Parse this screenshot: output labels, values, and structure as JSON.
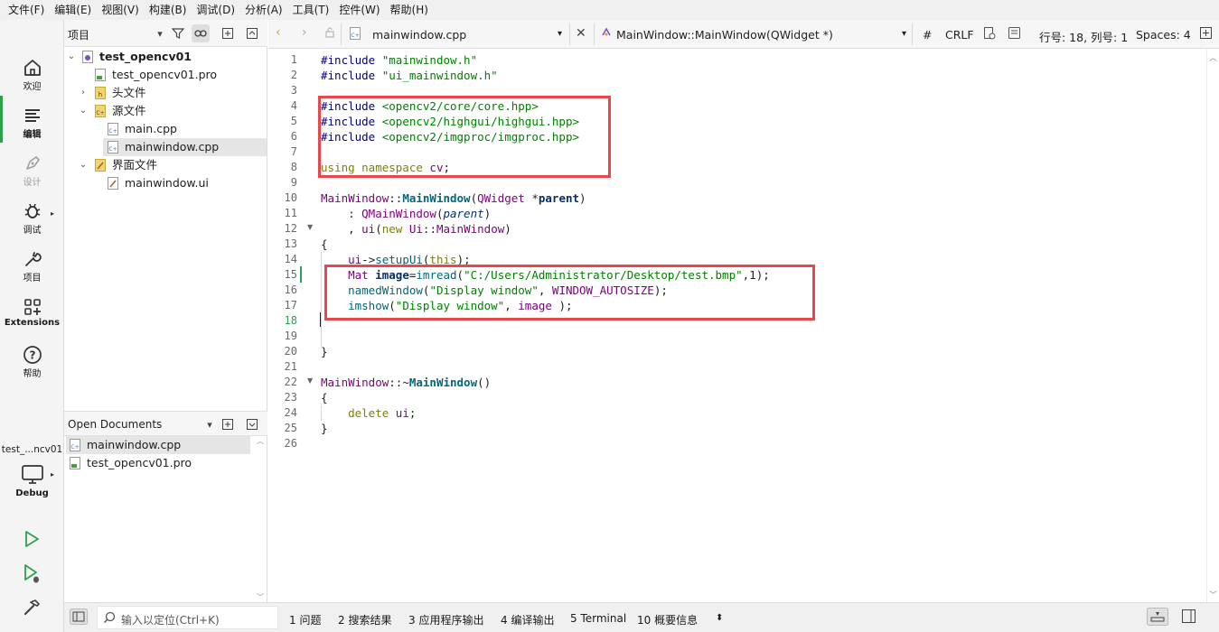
{
  "menu": [
    "文件(F)",
    "编辑(E)",
    "视图(V)",
    "构建(B)",
    "调试(D)",
    "分析(A)",
    "工具(T)",
    "控件(W)",
    "帮助(H)"
  ],
  "modes": [
    {
      "label": "欢迎",
      "icon": "home-icon"
    },
    {
      "label": "编辑",
      "icon": "edit-icon"
    },
    {
      "label": "设计",
      "icon": "design-icon"
    },
    {
      "label": "调试",
      "icon": "debug-icon"
    },
    {
      "label": "项目",
      "icon": "project-icon"
    },
    {
      "label": "Extensions",
      "icon": "extensions-icon"
    },
    {
      "label": "帮助",
      "icon": "help-icon"
    }
  ],
  "kit": {
    "project": "test_...ncv01",
    "mode": "Debug"
  },
  "project_panel": {
    "title": "项目",
    "tree": [
      {
        "label": "test_opencv01"
      },
      {
        "label": "test_opencv01.pro"
      },
      {
        "label": "头文件"
      },
      {
        "label": "源文件"
      },
      {
        "label": "main.cpp"
      },
      {
        "label": "mainwindow.cpp"
      },
      {
        "label": "界面文件"
      },
      {
        "label": "mainwindow.ui"
      }
    ]
  },
  "open_documents": {
    "title": "Open Documents",
    "items": [
      "mainwindow.cpp",
      "test_opencv01.pro"
    ]
  },
  "editor_toolbar": {
    "file": "mainwindow.cpp",
    "symbol": "MainWindow::MainWindow(QWidget *)",
    "hash": "#",
    "line_ending": "CRLF",
    "position": "行号: 18, 列号: 1",
    "indent": "Spaces: 4"
  },
  "editor": {
    "line_numbers": [
      "1",
      "2",
      "3",
      "4",
      "5",
      "6",
      "7",
      "8",
      "9",
      "10",
      "11",
      "12",
      "13",
      "14",
      "15",
      "16",
      "17",
      "18",
      "19",
      "20",
      "21",
      "22",
      "23",
      "24",
      "25",
      "26"
    ],
    "current_line": 18
  },
  "statusbar": {
    "locator_placeholder": "输入以定位(Ctrl+K)",
    "panes": [
      "1  问题",
      "2  搜索结果",
      "3  应用程序输出",
      "4  编译输出",
      "5  Terminal",
      "10  概要信息"
    ]
  },
  "colors": {
    "accent_green": "#2ea14f",
    "highlight_red": "#e5484d"
  }
}
